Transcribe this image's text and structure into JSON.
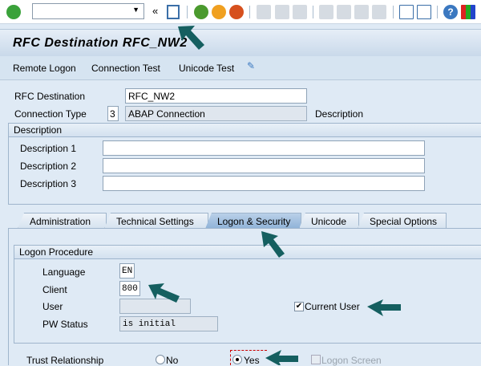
{
  "toolbar": {
    "icons": [
      "enter-icon",
      "command-field",
      "back-nav-icon",
      "save-icon",
      "back-icon",
      "exit-icon",
      "cancel-icon",
      "print-icon",
      "find-icon",
      "find-next-icon",
      "first-page-icon",
      "prev-page-icon",
      "next-page-icon",
      "last-page-icon",
      "new-session-icon",
      "shortcut-icon",
      "help-icon",
      "customize-layout-icon"
    ],
    "command_value": ""
  },
  "title": "RFC Destination RFC_NW2",
  "app_toolbar": {
    "remote_logon": "Remote Logon",
    "connection_test": "Connection Test",
    "unicode_test": "Unicode Test",
    "display_change_icon": "glasses-pencil-icon"
  },
  "header": {
    "rfc_destination_label": "RFC Destination",
    "rfc_destination_value": "RFC_NW2",
    "connection_type_label": "Connection Type",
    "connection_type_code": "3",
    "connection_type_value": "ABAP Connection",
    "description_label": "Description"
  },
  "description_group": {
    "title": "Description",
    "fields": [
      {
        "label": "Description 1",
        "value": ""
      },
      {
        "label": "Description 2",
        "value": ""
      },
      {
        "label": "Description 3",
        "value": ""
      }
    ]
  },
  "tabs": [
    {
      "label": "Administration"
    },
    {
      "label": "Technical Settings"
    },
    {
      "label": "Logon & Security",
      "active": true
    },
    {
      "label": "Unicode"
    },
    {
      "label": "Special Options"
    }
  ],
  "logon_procedure": {
    "title": "Logon Procedure",
    "language_label": "Language",
    "language_value": "EN",
    "client_label": "Client",
    "client_value": "800",
    "user_label": "User",
    "user_value": "",
    "pw_status_label": "PW Status",
    "pw_status_value": "is initial",
    "current_user_label": "Current User",
    "current_user_checked": true
  },
  "trust": {
    "label": "Trust Relationship",
    "no_label": "No",
    "yes_label": "Yes",
    "selected": "Yes",
    "logon_screen_label": "Logon Screen",
    "logon_screen_checked": false
  },
  "colors": {
    "arrow": "#155f60",
    "active_tab": "#a3c1e0",
    "background": "#dfeaf5"
  }
}
